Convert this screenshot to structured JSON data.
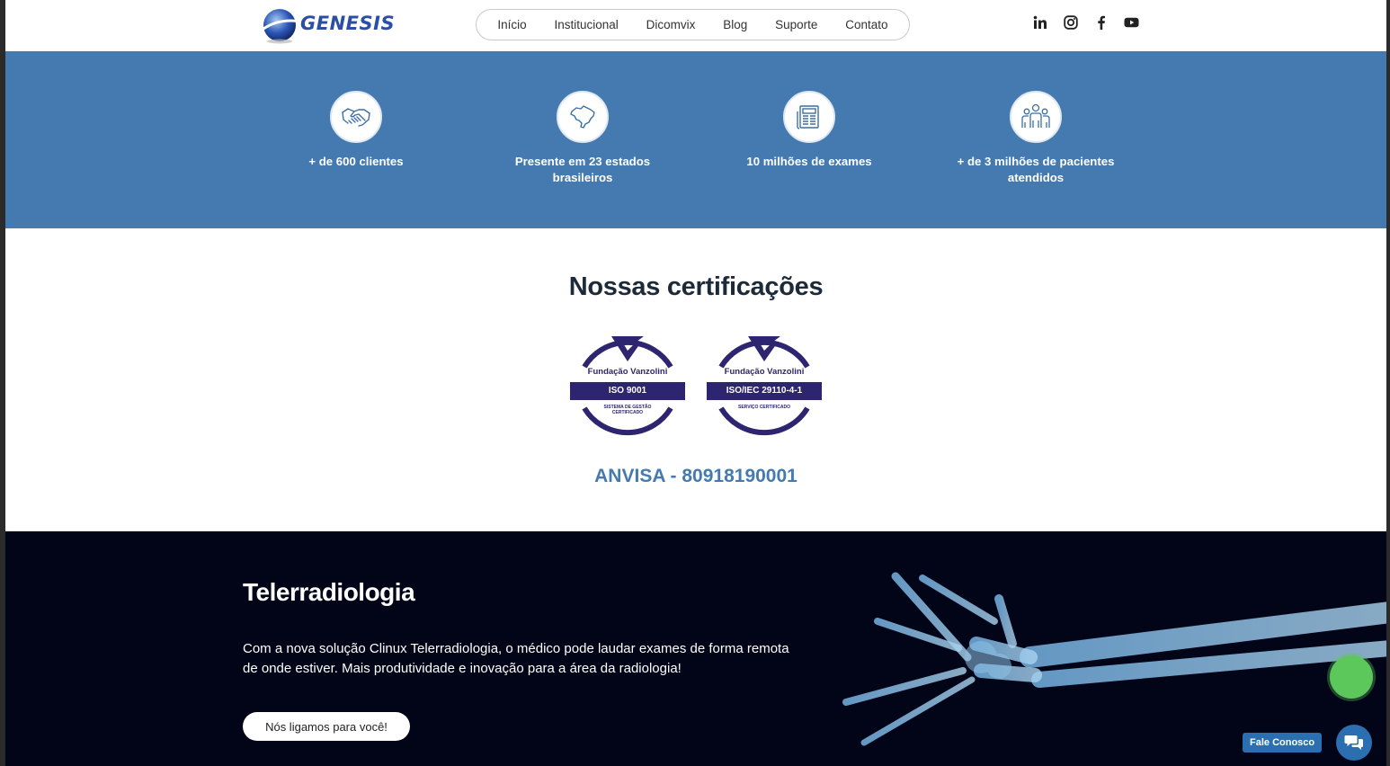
{
  "header": {
    "logo_text": "GENESIS",
    "nav": [
      "Início",
      "Institucional",
      "Dicomvix",
      "Blog",
      "Suporte",
      "Contato"
    ],
    "social_icons": [
      "linkedin-icon",
      "instagram-icon",
      "facebook-icon",
      "youtube-icon"
    ]
  },
  "stats": [
    {
      "icon": "handshake-icon",
      "label": "+ de 600 clientes"
    },
    {
      "icon": "brazil-map-icon",
      "label": "Presente em 23 estados brasileiros"
    },
    {
      "icon": "newspaper-icon",
      "label": "10 milhões de exames"
    },
    {
      "icon": "people-icon",
      "label": "+ de 3 milhões de pacientes atendidos"
    }
  ],
  "certifications": {
    "title": "Nossas certificações",
    "seals": [
      {
        "org": "Fundação Vanzolini",
        "standard": "ISO 9001",
        "caption_1": "SISTEMA DE GESTÃO",
        "caption_2": "CERTIFICADO"
      },
      {
        "org": "Fundação Vanzolini",
        "standard": "ISO/IEC 29110-4-1",
        "caption_1": "SERVIÇO CERTIFICADO",
        "caption_2": ""
      }
    ],
    "anvisa": "ANVISA - 80918190001",
    "seal_color": "#2e2570"
  },
  "hero": {
    "title": "Telerradiologia",
    "text": "Com a nova solução Clinux Telerradiologia, o médico pode laudar exames de forma remota de onde estiver. Mais produtividade e inovação para a área da radiologia!",
    "button": "Nós ligamos para você!"
  },
  "chat": {
    "label": "Fale Conosco"
  },
  "colors": {
    "accent_blue": "#457ab0",
    "hero_bg": "#020417",
    "chat_blue": "#2b6fb0"
  }
}
